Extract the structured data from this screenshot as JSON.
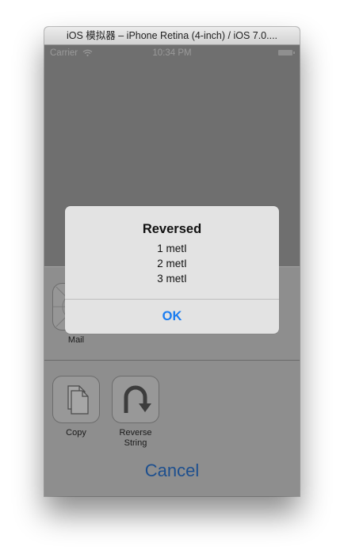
{
  "window": {
    "title": "iOS 模拟器 – iPhone Retina (4-inch) / iOS 7.0...."
  },
  "statusbar": {
    "carrier": "Carrier",
    "time": "10:34 PM"
  },
  "share_sheet": {
    "items": [
      {
        "label": "Mail",
        "icon": "mail-icon"
      },
      {
        "label": "Copy",
        "icon": "copy-icon"
      },
      {
        "label": "Reverse\nString",
        "icon": "reverse-arrow-icon"
      }
    ],
    "cancel_label": "Cancel"
  },
  "alert": {
    "title": "Reversed",
    "lines": [
      "1 metI",
      "2 metI",
      "3 metI"
    ],
    "ok_label": "OK"
  },
  "colors": {
    "accent": "#1a7cf0",
    "cancel": "#1d4f8e"
  }
}
